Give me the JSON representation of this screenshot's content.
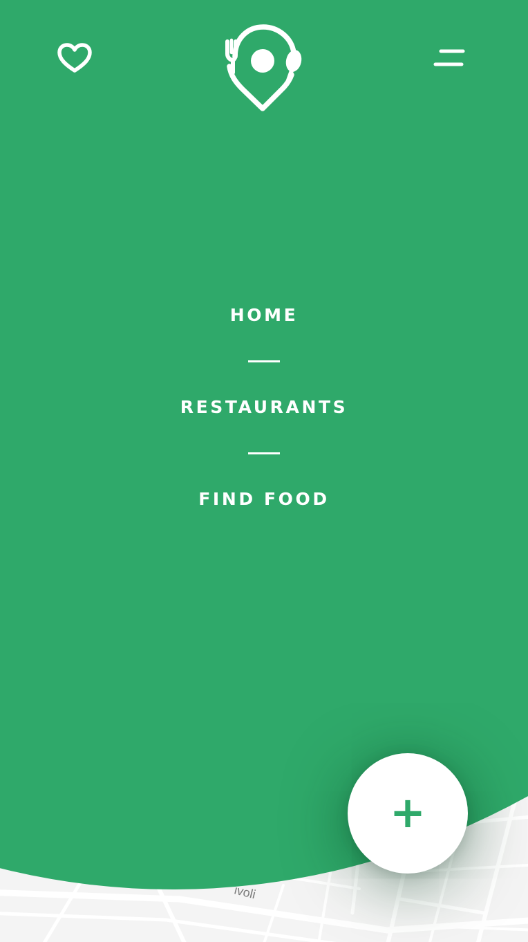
{
  "colors": {
    "accent": "#2fa96a",
    "on_accent": "#ffffff",
    "map_background": "#f4f4f4",
    "map_roads": "#ffffff"
  },
  "header": {
    "left_icon": "heart-icon",
    "logo_icon": "location-pin-fork-spoon-icon",
    "right_icon": "hamburger-menu-icon"
  },
  "nav": {
    "items": [
      {
        "label": "HOME"
      },
      {
        "label": "RESTAURANTS"
      },
      {
        "label": "FIND FOOD"
      }
    ]
  },
  "fab": {
    "label": "+",
    "icon": "plus-icon"
  },
  "map": {
    "street_label": "ivoli"
  }
}
